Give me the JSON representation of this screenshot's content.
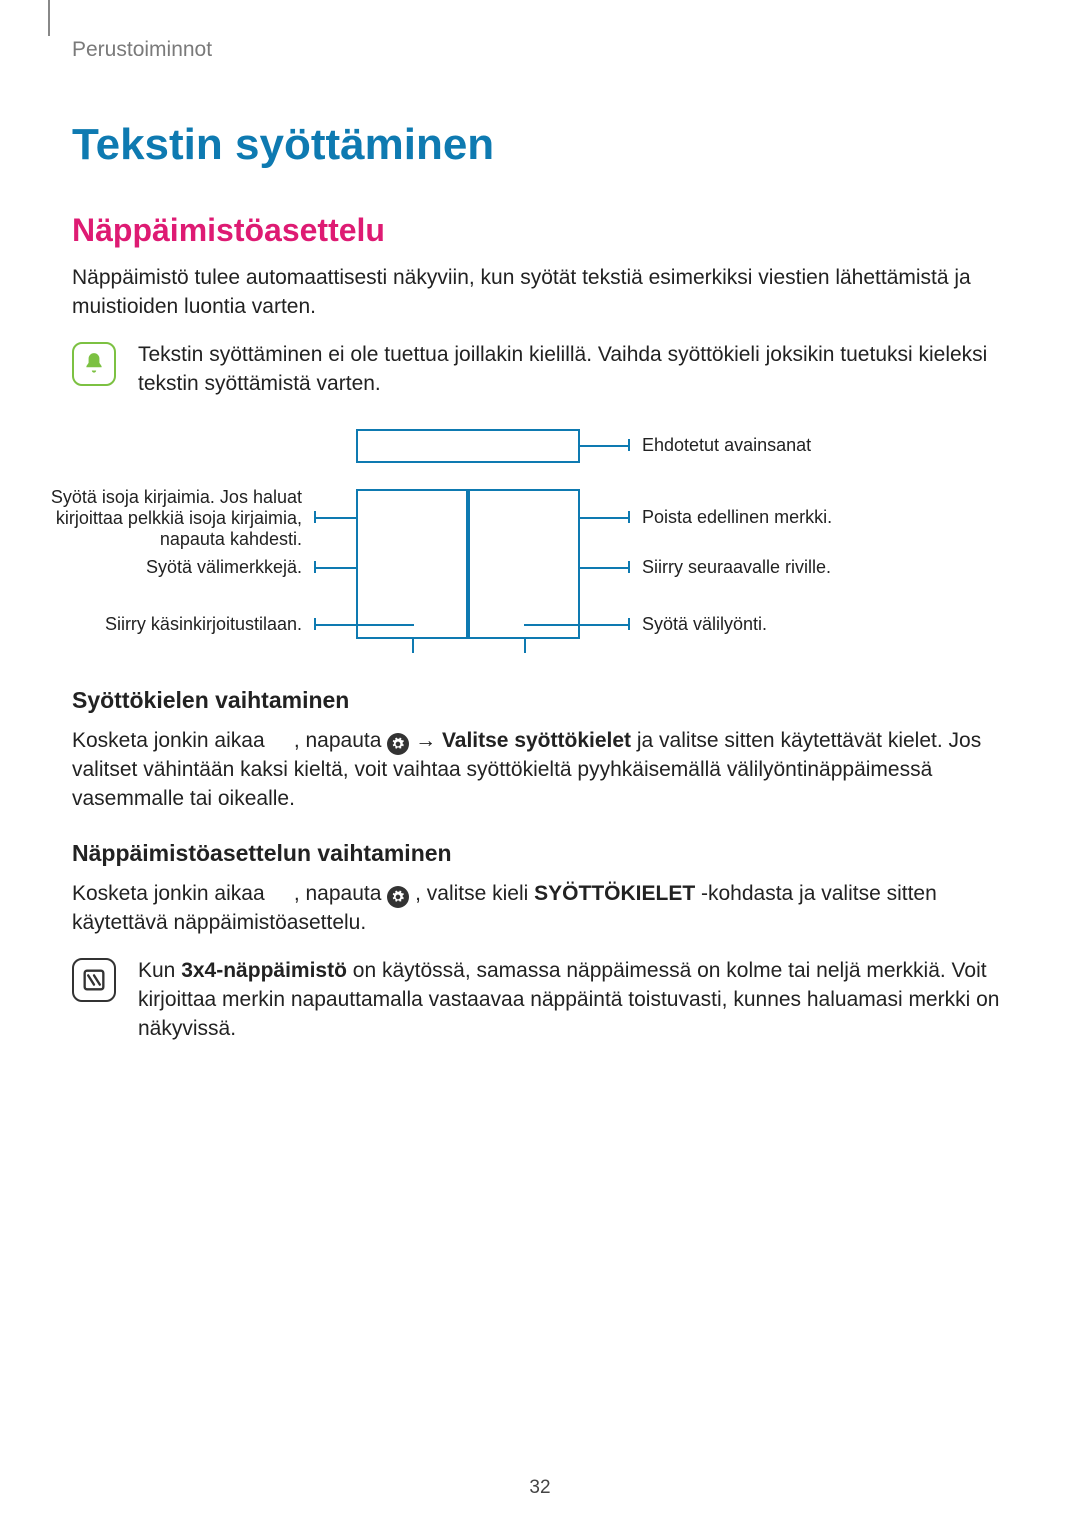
{
  "breadcrumb": "Perustoiminnot",
  "h1": "Tekstin syöttäminen",
  "h2": "Näppäimistöasettelu",
  "intro_p": "Näppäimistö tulee automaattisesti näkyviin, kun syötät tekstiä esimerkiksi viestien lähettämistä ja muistioiden luontia varten.",
  "note1": "Tekstin syöttäminen ei ole tuettua joillakin kielillä. Vaihda syöttökieli joksikin tuetuksi kieleksi tekstin syöttämistä varten.",
  "diagram": {
    "left": {
      "caps": "Syötä isoja kirjaimia. Jos haluat kirjoittaa pelkkiä isoja kirjaimia, napauta kahdesti.",
      "symbols": "Syötä välimerkkejä.",
      "handwrite": "Siirry käsinkirjoitustilaan."
    },
    "right": {
      "suggest": "Ehdotetut avainsanat",
      "delete": "Poista edellinen merkki.",
      "newline": "Siirry seuraavalle riville.",
      "space": "Syötä välilyönti."
    }
  },
  "h3a": "Syöttökielen vaihtaminen",
  "p3a_1": "Kosketa jonkin aikaa ",
  "p3a_2": ", napauta ",
  "p3a_arrow": " → ",
  "p3a_bold": "Valitse syöttökielet",
  "p3a_3": " ja valitse sitten käytettävät kielet. Jos valitset vähintään kaksi kieltä, voit vaihtaa syöttökieltä pyyhkäisemällä välilyöntinäppäimessä vasemmalle tai oikealle.",
  "h3b": "Näppäimistöasettelun vaihtaminen",
  "p3b_1": "Kosketa jonkin aikaa ",
  "p3b_2": ", napauta ",
  "p3b_3": ", valitse kieli ",
  "p3b_bold": "SYÖTTÖKIELET",
  "p3b_4": "-kohdasta ja valitse sitten käytettävä näppäimistöasettelu.",
  "note2_a": "Kun ",
  "note2_bold": "3x4-näppäimistö",
  "note2_b": " on käytössä, samassa näppäimessä on kolme tai neljä merkkiä. Voit kirjoittaa merkin napauttamalla vastaavaa näppäintä toistuvasti, kunnes haluamasi merkki on näkyvissä.",
  "page_number": "32"
}
